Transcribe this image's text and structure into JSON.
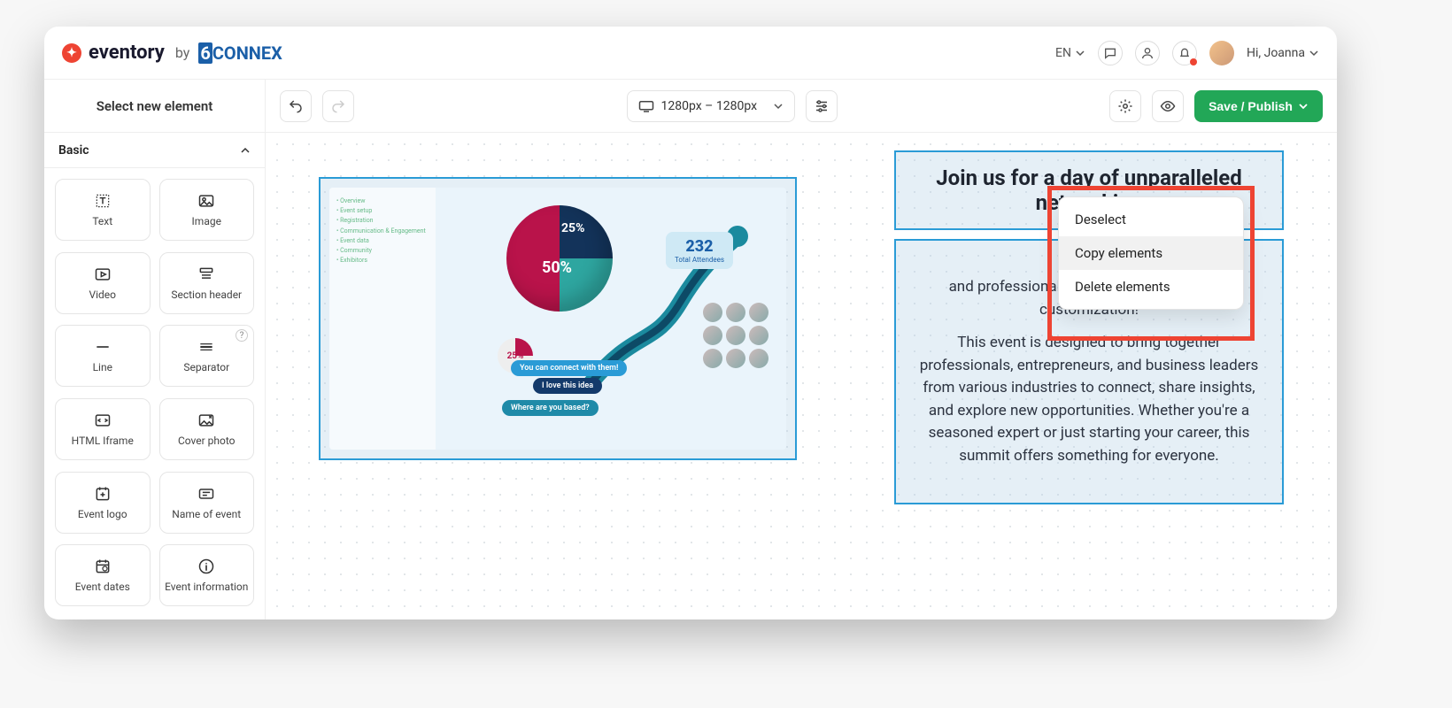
{
  "brand": {
    "name": "eventory",
    "by": "by",
    "partner": "CONNEX",
    "partner_prefix": "6"
  },
  "topbar": {
    "lang": "EN",
    "greeting": "Hi, Joanna"
  },
  "sidebar": {
    "title": "Select new element",
    "section": "Basic",
    "elements": [
      {
        "label": "Text",
        "icon": "text"
      },
      {
        "label": "Image",
        "icon": "image"
      },
      {
        "label": "Video",
        "icon": "video"
      },
      {
        "label": "Section header",
        "icon": "section"
      },
      {
        "label": "Line",
        "icon": "line"
      },
      {
        "label": "Separator",
        "icon": "separator",
        "help": true
      },
      {
        "label": "HTML Iframe",
        "icon": "iframe"
      },
      {
        "label": "Cover photo",
        "icon": "cover"
      },
      {
        "label": "Event logo",
        "icon": "logo"
      },
      {
        "label": "Name of event",
        "icon": "name"
      },
      {
        "label": "Event dates",
        "icon": "dates"
      },
      {
        "label": "Event information",
        "icon": "info"
      }
    ]
  },
  "toolbar": {
    "breakpoint": "1280px – 1280px",
    "save": "Save / Publish"
  },
  "canvas": {
    "heading": "Join us for a day of unparalleled networking",
    "subheading_lead": "and professional growth at the event page customization!",
    "body": "This event is designed to bring together professionals, entrepreneurs, and business leaders from various industries to connect, share insights, and explore new opportunities. Whether you're a seasoned expert or just starting your career, this summit offers something for everyone.",
    "dashboard": {
      "pie": {
        "seg1": "25%",
        "seg2": "50%"
      },
      "mini_pie": "25%",
      "stat": {
        "value": "232",
        "label": "Total Attendees"
      },
      "bubbles": [
        "You can connect with them!",
        "I love this idea",
        "Where are you based?"
      ],
      "sidebar_items": [
        "Overview",
        "Event setup",
        "Registration",
        "Communication & Engagement",
        "Event data",
        "Community",
        "Exhibitors"
      ]
    }
  },
  "context_menu": {
    "items": [
      "Deselect",
      "Copy elements",
      "Delete elements"
    ],
    "hover_index": 1
  }
}
